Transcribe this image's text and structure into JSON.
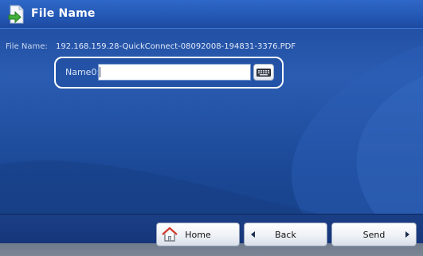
{
  "window": {
    "title": "File Name",
    "title_icon": "document-arrow-icon"
  },
  "file_name": {
    "label": "File Name:",
    "value": "192.168.159.28-QuickConnect-08092008-194831-3376.PDF"
  },
  "name_field": {
    "label": "Name0:",
    "value": "",
    "keyboard_icon": "keyboard-icon"
  },
  "footer": {
    "home_label": "Home",
    "home_icon": "home-icon",
    "back_label": "Back",
    "back_icon": "triangle-left-icon",
    "send_label": "Send",
    "send_icon": "triangle-right-icon"
  },
  "colors": {
    "background": "#1e4a9b",
    "title_bar": "#2357b4",
    "highlight_border": "#ffffff",
    "button_face": "#eef1f6"
  }
}
